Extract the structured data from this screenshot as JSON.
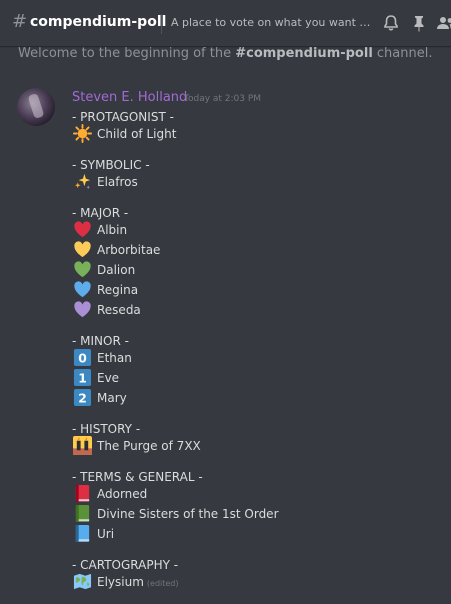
{
  "header": {
    "channel_name": "compendium-poll",
    "topic": "A place to vote on what you want to see in the compendium"
  },
  "welcome": {
    "prefix": "Welcome to the beginning of the ",
    "channel": "#compendium-poll",
    "suffix": " channel."
  },
  "message": {
    "author": "Steven E. Holland",
    "timestamp": "Today at 2:03 PM",
    "edited_label": "(edited)",
    "sections": [
      {
        "heading": "- PROTAGONIST -",
        "items": [
          {
            "icon": "sun-icon",
            "label": "Child of Light"
          }
        ]
      },
      {
        "heading": "- SYMBOLIC -",
        "items": [
          {
            "icon": "sparkles-icon",
            "label": "Elafros"
          }
        ]
      },
      {
        "heading": "- MAJOR -",
        "items": [
          {
            "icon": "red-heart-icon",
            "label": "Albin",
            "color": "#dd2e44"
          },
          {
            "icon": "yellow-heart-icon",
            "label": "Arborbitae",
            "color": "#fdcb58"
          },
          {
            "icon": "green-heart-icon",
            "label": "Dalion",
            "color": "#78b159"
          },
          {
            "icon": "blue-heart-icon",
            "label": "Regina",
            "color": "#5dadec"
          },
          {
            "icon": "purple-heart-icon",
            "label": "Reseda",
            "color": "#aa8ed6"
          }
        ]
      },
      {
        "heading": "- MINOR -",
        "items": [
          {
            "icon": "keycap-zero-icon",
            "keycap": "0",
            "label": "Ethan"
          },
          {
            "icon": "keycap-one-icon",
            "keycap": "1",
            "label": "Eve"
          },
          {
            "icon": "keycap-two-icon",
            "keycap": "2",
            "label": "Mary"
          }
        ]
      },
      {
        "heading": "- HISTORY -",
        "items": [
          {
            "icon": "fire-tower-icon",
            "label": "The Purge of 7XX"
          }
        ]
      },
      {
        "heading": "- TERMS & GENERAL -",
        "items": [
          {
            "icon": "red-book-icon",
            "label": "Adorned",
            "color": "#dd2e44"
          },
          {
            "icon": "green-book-icon",
            "label": "Divine Sisters of the 1st Order",
            "color": "#5c913b"
          },
          {
            "icon": "blue-book-icon",
            "label": "Uri",
            "color": "#3b88c3"
          }
        ]
      },
      {
        "heading": "- CARTOGRAPHY -",
        "items": [
          {
            "icon": "world-map-icon",
            "label": "Elysium",
            "edited": true
          }
        ]
      }
    ]
  },
  "colors": {
    "background": "#36393f",
    "author": "#a16bd6",
    "text": "#dcddde",
    "muted": "#72767d",
    "keycap": "#3b88c3"
  }
}
